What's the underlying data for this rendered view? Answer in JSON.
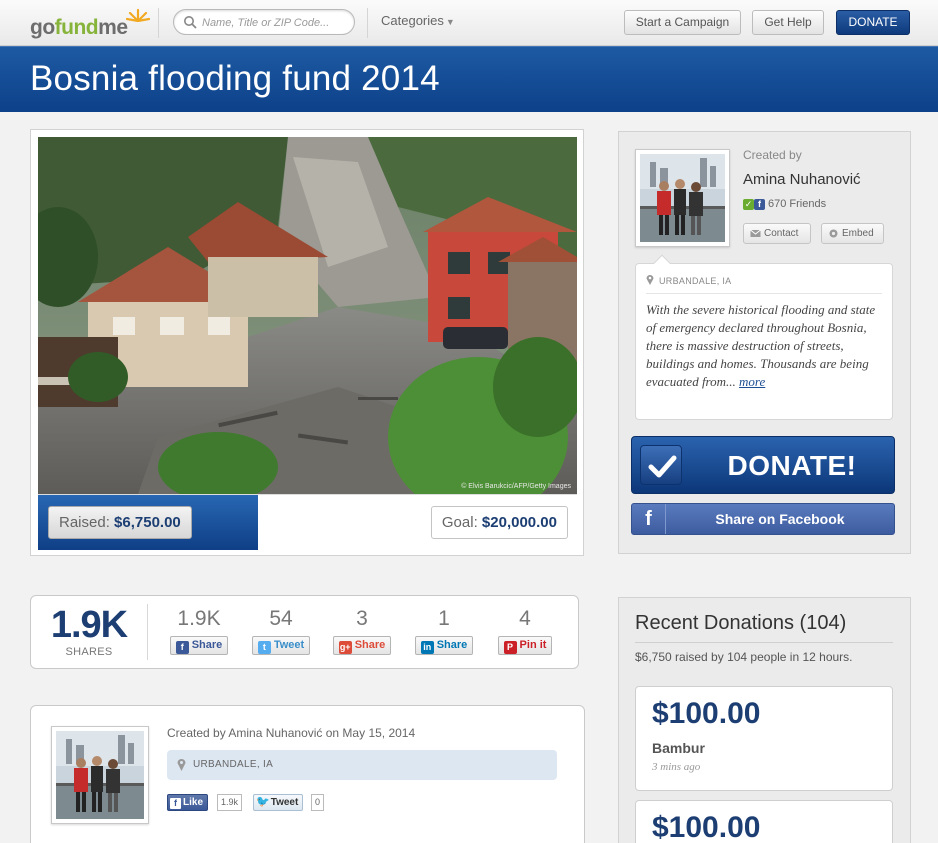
{
  "nav": {
    "logo": {
      "go": "go",
      "fund": "fund",
      "me": "me"
    },
    "search_placeholder": "Name, Title or ZIP Code...",
    "categories": "Categories",
    "start_campaign": "Start a Campaign",
    "get_help": "Get Help",
    "donate": "DONATE"
  },
  "campaign": {
    "title": "Bosnia flooding fund 2014",
    "photo_credit": "© Elvis Barukcic/AFP/Getty Images",
    "raised_label": "Raised:",
    "raised_value": "$6,750.00",
    "goal_label": "Goal:",
    "goal_value": "$20,000.00",
    "progress_fraction": 0.3375
  },
  "creator": {
    "created_by": "Created by",
    "name": "Amina Nuhanović",
    "friends": "670 Friends",
    "contact": "Contact",
    "embed": "Embed",
    "location": "URBANDALE, IA",
    "description": "With the severe historical flooding and state of emergency declared throughout Bosnia, there is massive destruction of streets, buildings and homes. Thousands are being evacuated from...",
    "more": "more",
    "donate_button": "DONATE!",
    "facebook_share": "Share on Facebook"
  },
  "shares": {
    "total": "1.9K",
    "total_label": "SHARES",
    "items": [
      {
        "count": "1.9K",
        "label": "Share",
        "color": "#3b5998",
        "glyph": "f"
      },
      {
        "count": "54",
        "label": "Tweet",
        "color": "#55acee",
        "glyph": "t"
      },
      {
        "count": "3",
        "label": "Share",
        "color": "#dd4b39",
        "glyph": "g+"
      },
      {
        "count": "1",
        "label": "Share",
        "color": "#0077b5",
        "glyph": "in"
      },
      {
        "count": "4",
        "label": "Pin it",
        "color": "#cb2027",
        "glyph": "P"
      }
    ]
  },
  "post": {
    "created_line": "Created by Amina Nuhanović on May 15, 2014",
    "location": "URBANDALE, IA",
    "like": "Like",
    "like_count": "1.9k",
    "tweet": "Tweet",
    "tweet_count": "0"
  },
  "donations": {
    "title": "Recent Donations (104)",
    "summary": "$6,750 raised by 104 people in 12 hours.",
    "items": [
      {
        "amount": "$100.00",
        "name": "Bambur",
        "time": "3 mins ago"
      },
      {
        "amount": "$100.00",
        "name": "",
        "time": ""
      }
    ]
  }
}
